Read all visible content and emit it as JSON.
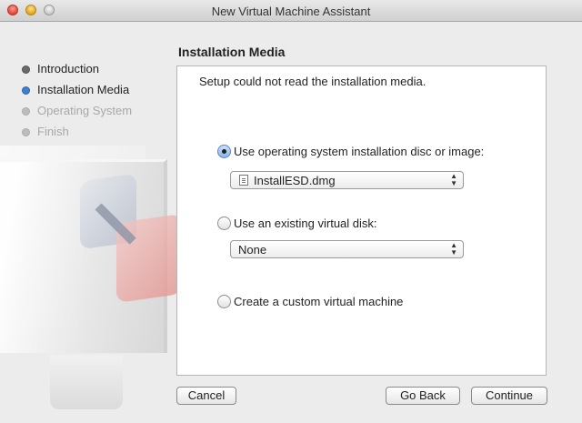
{
  "window": {
    "title": "New Virtual Machine Assistant"
  },
  "steps": [
    {
      "label": "Introduction",
      "state": "done"
    },
    {
      "label": "Installation Media",
      "state": "current"
    },
    {
      "label": "Operating System",
      "state": "todo"
    },
    {
      "label": "Finish",
      "state": "todo"
    }
  ],
  "page": {
    "heading": "Installation Media",
    "message": "Setup could not read the installation media."
  },
  "options": {
    "disc": {
      "label": "Use operating system installation disc or image:",
      "selected": true,
      "value": "InstallESD.dmg",
      "icon": "disk-image-icon"
    },
    "existing": {
      "label": "Use an existing virtual disk:",
      "selected": false,
      "value": "None"
    },
    "custom": {
      "label": "Create a custom virtual machine",
      "selected": false
    }
  },
  "buttons": {
    "cancel": "Cancel",
    "back": "Go Back",
    "continue": "Continue"
  },
  "colors": {
    "accent": "#3f7fd0"
  }
}
